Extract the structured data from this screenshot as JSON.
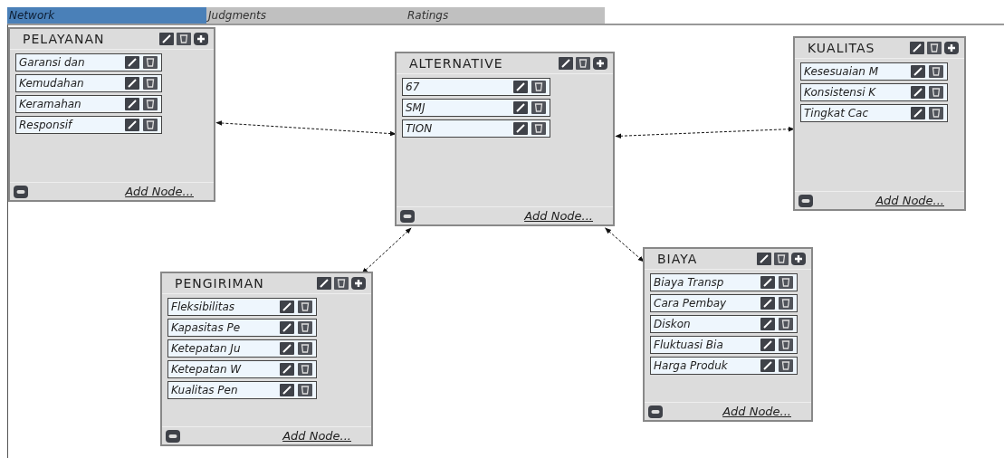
{
  "tabs": [
    {
      "label": "Network",
      "selected": true
    },
    {
      "label": "Judgments",
      "selected": false
    },
    {
      "label": "Ratings",
      "selected": false
    }
  ],
  "clusters": [
    {
      "title": "PELAYANAN",
      "nodes": [
        "Garansi dan",
        "Kemudahan",
        "Keramahan",
        "Responsif"
      ],
      "add_link": "Add Node..."
    },
    {
      "title": "ALTERNATIVE",
      "nodes": [
        "67",
        "SMJ",
        "TION"
      ],
      "add_link": "Add Node..."
    },
    {
      "title": "KUALITAS",
      "nodes": [
        "Kesesuaian M",
        "Konsistensi K",
        "Tingkat Cac"
      ],
      "add_link": "Add Node..."
    },
    {
      "title": "PENGIRIMAN",
      "nodes": [
        "Fleksibilitas",
        "Kapasitas Pe",
        "Ketepatan Ju",
        "Ketepatan W",
        "Kualitas Pen"
      ],
      "add_link": "Add Node..."
    },
    {
      "title": "BIAYA",
      "nodes": [
        "Biaya Transp",
        "Cara Pembay",
        "Diskon",
        "Fluktuasi Bia",
        "Harga Produk"
      ],
      "add_link": "Add Node..."
    }
  ]
}
